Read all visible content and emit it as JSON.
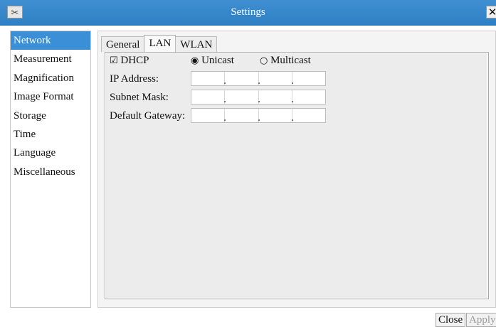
{
  "window": {
    "title": "Settings",
    "icon": "tools-icon",
    "close_glyph": "✕"
  },
  "sidebar": {
    "items": [
      {
        "label": "Network",
        "active": true
      },
      {
        "label": "Measurement"
      },
      {
        "label": "Magnification"
      },
      {
        "label": "Image Format"
      },
      {
        "label": "Storage"
      },
      {
        "label": "Time"
      },
      {
        "label": "Language"
      },
      {
        "label": "Miscellaneous"
      }
    ]
  },
  "tabs": [
    {
      "label": "General"
    },
    {
      "label": "LAN",
      "active": true
    },
    {
      "label": "WLAN"
    }
  ],
  "lan": {
    "dhcp": {
      "label": "DHCP",
      "checked": true,
      "glyph": "☑"
    },
    "mode_options": [
      {
        "label": "Unicast",
        "selected": true,
        "glyph": "◉"
      },
      {
        "label": "Multicast",
        "selected": false,
        "glyph": "○"
      }
    ],
    "fields": [
      {
        "label": "IP Address:"
      },
      {
        "label": "Subnet Mask:"
      },
      {
        "label": "Default Gateway:"
      }
    ]
  },
  "footer": {
    "close_label": "Close",
    "apply_label": "Apply"
  },
  "colors": {
    "titlebar": "#3f8fd2",
    "selection": "#3a8fd6"
  }
}
